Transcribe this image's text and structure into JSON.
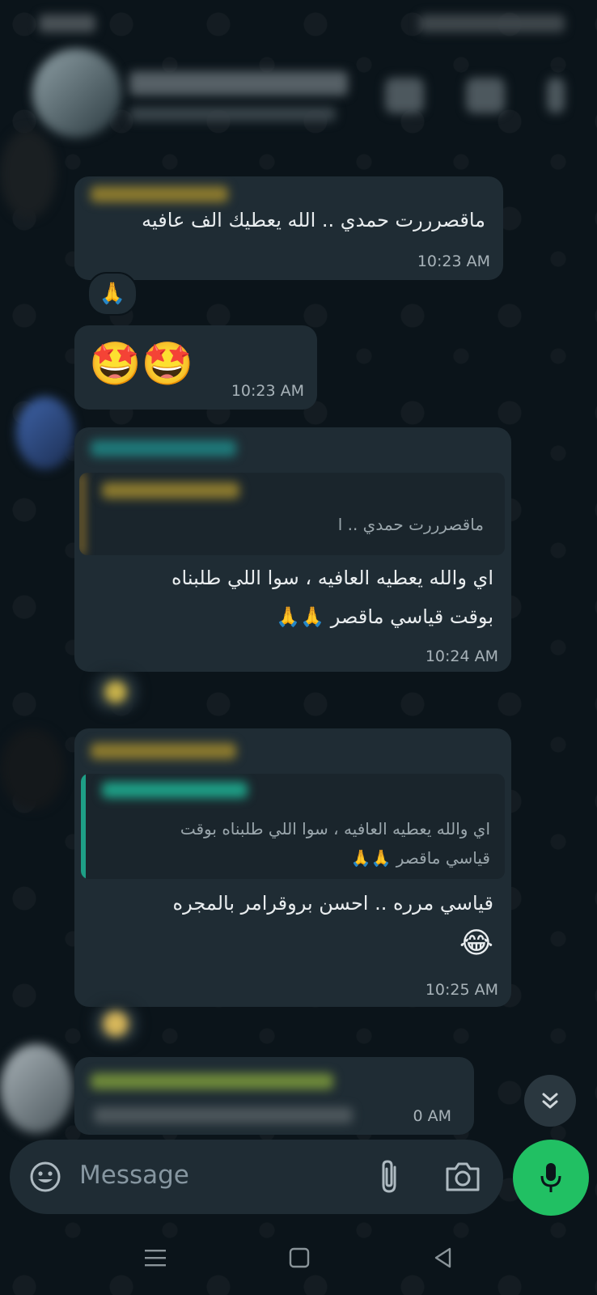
{
  "composer": {
    "placeholder": "Message"
  },
  "messages": [
    {
      "text": "ماقصرررت حمدي .. الله يعطيك الف عافيه",
      "time": "10:23 AM",
      "reaction": "🙏"
    },
    {
      "text": "🤩🤩",
      "time": "10:23 AM"
    },
    {
      "quote": "ماقصرررت حمدي .. ا",
      "text_line1": "اي والله يعطيه العافيه ، سوا اللي طلبناه",
      "text_line2": "بوقت قياسي ماقصر 🙏🙏",
      "time": "10:24 AM"
    },
    {
      "quote_line1": "اي والله يعطيه العافيه ، سوا اللي طلبناه بوقت",
      "quote_line2": "قياسي ماقصر 🙏🙏",
      "text_line1": "قياسي مرره .. احسن بروقرامر بالمجره",
      "text_line2": "😂",
      "time": "10:25 AM"
    },
    {
      "time_partial": "0 AM"
    }
  ],
  "colors": {
    "background": "#0b141a",
    "bubble": "#1f2c34",
    "accent": "#21c063",
    "quote_bar_gold": "#b58a2a",
    "quote_bar_teal": "#1e9f86"
  },
  "icons": [
    "video-call-icon",
    "voice-call-icon",
    "more-icon",
    "emoji-icon",
    "attach-icon",
    "camera-icon",
    "mic-icon",
    "scroll-down-icon",
    "menu-icon",
    "home-icon",
    "back-icon"
  ]
}
